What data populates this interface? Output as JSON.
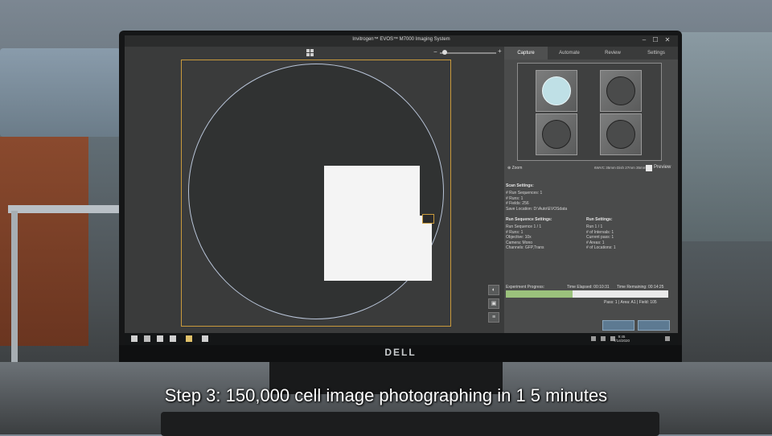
{
  "window": {
    "title": "Invitrogen™ EVOS™ M7000 Imaging System",
    "minimize": "–",
    "maximize": "☐",
    "close": "✕"
  },
  "viewer": {
    "zoom_minus": "−",
    "zoom_plus": "+",
    "tools": [
      "◐",
      "▣",
      "≡"
    ]
  },
  "tabs": [
    {
      "label": "Capture",
      "active": true
    },
    {
      "label": "Automate",
      "active": false
    },
    {
      "label": "Review",
      "active": false
    },
    {
      "label": "Settings",
      "active": false
    }
  ],
  "plate": {
    "wells": 4,
    "selected_well_index": 0,
    "zoom_label": "⊕ Zoom",
    "name": "6WVC 35mm Dish 27mm 35mm",
    "preview_label": "Preview",
    "preview_checked": true
  },
  "scan_settings": {
    "header": "Scan Settings:",
    "lines": [
      "# Run Sequences: 1",
      "# Runs: 1",
      "# Fields: 256",
      "Save Location: D:\\Auto\\EVOSdata"
    ]
  },
  "run_sequence_settings": {
    "header": "Run Sequence Settings:",
    "lines": [
      "Run Sequence 1 / 1",
      "# Runs: 1",
      "Objective: 10x",
      "Camera: Mono",
      "Channels: GFP,Trans"
    ]
  },
  "run_settings": {
    "header": "Run Settings:",
    "lines": [
      "Run 1 / 1",
      "# of Intervals: 1",
      "Current pass: 1",
      "# Areas: 1",
      "# of Locations: 1"
    ]
  },
  "progress": {
    "label": "Experiment Progress:",
    "time_elapsed": "Time Elapsed: 00:10:31",
    "time_remaining": "Time Remaining: 00:14:25",
    "fraction": 0.41,
    "pass_text": "Pass: 1 | Area: A1 | Field: 105"
  },
  "buttons": {
    "left": "",
    "right": ""
  },
  "taskbar": {
    "time": "9:45",
    "date": "7/14/2020"
  },
  "colors": {
    "progress_fill": "#9bc27c",
    "scan_border": "#c99a3c",
    "well_selected": "#bfe0e6"
  },
  "caption": "Step 3: 150,000 cell image photographing in 1 5 minutes",
  "monitor_brand": "DELL"
}
